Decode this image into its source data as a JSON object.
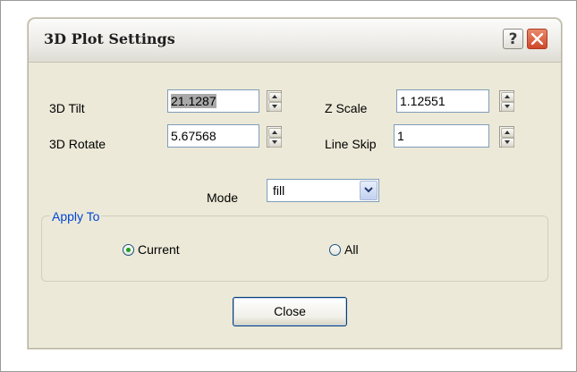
{
  "dialog": {
    "title": "3D Plot Settings",
    "help_label": "?",
    "close_icon": "close-x-icon"
  },
  "fields": {
    "tilt": {
      "label": "3D Tilt",
      "value": "21.1287"
    },
    "rotate": {
      "label": "3D Rotate",
      "value": "5.67568"
    },
    "zscale": {
      "label": "Z Scale",
      "value": "1.12551"
    },
    "lineskip": {
      "label": "Line Skip",
      "value": "1"
    }
  },
  "mode": {
    "label": "Mode",
    "value": "fill"
  },
  "apply_to": {
    "legend": "Apply To",
    "options": [
      {
        "label": "Current",
        "checked": true
      },
      {
        "label": "All",
        "checked": false
      }
    ]
  },
  "buttons": {
    "close_label": "Close"
  },
  "colors": {
    "dialog_bg": "#ece9d8",
    "group_legend": "#0046d5",
    "close_x": "#d0472a"
  }
}
